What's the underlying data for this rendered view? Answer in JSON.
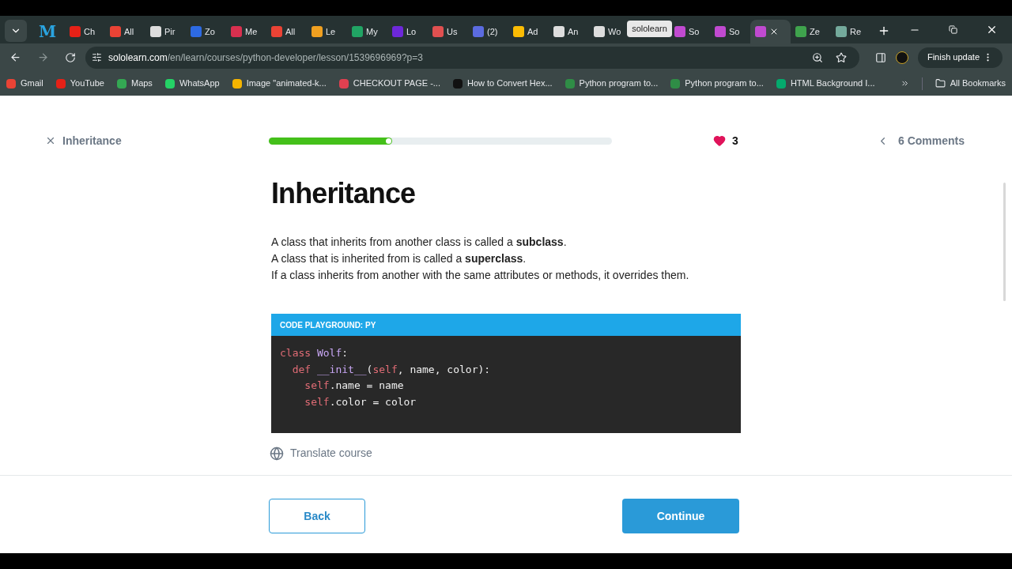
{
  "tabs": [
    {
      "color": "#2aa4e0",
      "selected": false,
      "kind": "letter",
      "glyph": "M"
    },
    {
      "label": "Ch",
      "color": "#e62117",
      "selected": false
    },
    {
      "label": "All",
      "color": "#ea4335",
      "selected": false
    },
    {
      "label": "Pir",
      "color": "#dddddd",
      "selected": false
    },
    {
      "label": "Zo",
      "color": "#2d6ae3",
      "selected": false
    },
    {
      "label": "Me",
      "color": "#d9304f",
      "selected": false
    },
    {
      "label": "All",
      "color": "#ea4335",
      "selected": false
    },
    {
      "label": "Le",
      "color": "#f0a020",
      "selected": false
    },
    {
      "label": "My",
      "color": "#21a464",
      "selected": false
    },
    {
      "label": "Lo",
      "color": "#6d28d9",
      "selected": false
    },
    {
      "label": "Us",
      "color": "#e05050",
      "selected": false
    },
    {
      "label": "(2)",
      "color": "#5b6be0",
      "selected": false
    },
    {
      "label": "Ad",
      "color": "#fbbc04",
      "selected": false
    },
    {
      "label": "An",
      "color": "#dddddd",
      "selected": false
    },
    {
      "label": "Wo",
      "color": "#dddddd",
      "selected": false,
      "tooltip": "sololearn"
    },
    {
      "label": "So",
      "color": "#c04ad0",
      "selected": false
    },
    {
      "label": "So",
      "color": "#c04ad0",
      "selected": false
    },
    {
      "color": "#c04ad0",
      "selected": true
    },
    {
      "label": "Ze",
      "color": "#3fa34d",
      "selected": false
    },
    {
      "label": "Re",
      "color": "#74aa9c",
      "selected": false
    }
  ],
  "address": {
    "host": "sololearn.com",
    "path": "/en/learn/courses/python-developer/lesson/1539696969?p=3"
  },
  "update_button": "Finish update",
  "bookmarks": [
    {
      "label": "Gmail",
      "color": "#ea4335"
    },
    {
      "label": "YouTube",
      "color": "#e62117"
    },
    {
      "label": "Maps",
      "color": "#34a853"
    },
    {
      "label": "WhatsApp",
      "color": "#25d366"
    },
    {
      "label": "Image \"animated-k...",
      "color": "#f5b400"
    },
    {
      "label": "CHECKOUT PAGE -...",
      "color": "#e04050"
    },
    {
      "label": "How to Convert Hex...",
      "color": "#111111"
    },
    {
      "label": "Python program to...",
      "color": "#2f8d46"
    },
    {
      "label": "Python program to...",
      "color": "#2f8d46"
    },
    {
      "label": "HTML Background I...",
      "color": "#04aa6d"
    }
  ],
  "all_bookmarks": "All Bookmarks",
  "lesson": {
    "close_label": "Inheritance",
    "progress": {
      "level": 0.36
    },
    "hearts": "3",
    "comments": "6 Comments",
    "title": "Inheritance",
    "paragraphs": [
      "A class that inherits from another class is called a **subclass**.",
      "A class that is inherited from is called a **superclass**.",
      "If a class inherits from another with the same attributes or methods, it overrides them."
    ],
    "code": {
      "header": "CODE PLAYGROUND: PY",
      "lines": [
        [
          {
            "kind": "keyword",
            "text": "class "
          },
          {
            "kind": "name",
            "text": "Wolf"
          },
          {
            "kind": "plain",
            "text": ":"
          }
        ],
        [
          {
            "kind": "keyword",
            "text": "  def "
          },
          {
            "kind": "name",
            "text": "__init__"
          },
          {
            "kind": "plain",
            "text": "("
          },
          {
            "kind": "keyword",
            "text": "self"
          },
          {
            "kind": "plain",
            "text": ", name, color):"
          }
        ],
        [
          {
            "kind": "keyword",
            "text": "    self"
          },
          {
            "kind": "plain",
            "text": ".name = name"
          }
        ],
        [
          {
            "kind": "keyword",
            "text": "    self"
          },
          {
            "kind": "plain",
            "text": ".color = color"
          }
        ]
      ]
    },
    "translate": "Translate course",
    "back": "Back",
    "continue": "Continue"
  }
}
